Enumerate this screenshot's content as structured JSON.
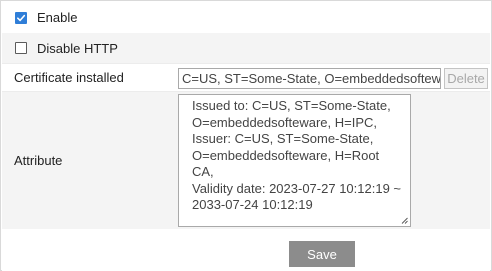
{
  "enable": {
    "label": "Enable",
    "checked": true
  },
  "disable_http": {
    "label": "Disable HTTP",
    "checked": false
  },
  "certificate": {
    "label": "Certificate installed",
    "value": "C=US, ST=Some-State, O=embeddedsoftewa",
    "delete_label": "Delete"
  },
  "attribute": {
    "label": "Attribute",
    "lines": [
      "Issued to: C=US, ST=Some-State,",
      "O=embeddedsofteware, H=IPC,",
      "Issuer: C=US, ST=Some-State,",
      "O=embeddedsofteware, H=Root",
      "CA,",
      "Validity date: 2023-07-27 10:12:19 ~",
      "2033-07-24 10:12:19"
    ]
  },
  "save_label": "Save",
  "colors": {
    "checkbox_accent": "#2f7ed8",
    "save_button": "#8c8c8c",
    "row_alt": "#f4f4f4"
  }
}
